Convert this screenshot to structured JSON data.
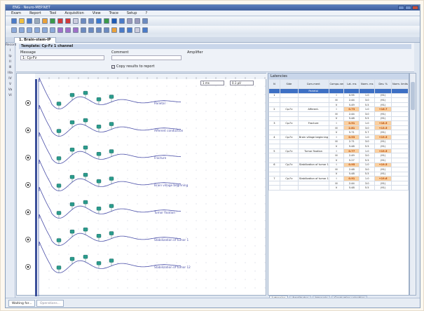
{
  "window": {
    "title": "ENG · Neuro-MEP.NET"
  },
  "menu": [
    "Exam",
    "Report",
    "Tool",
    "Acquisition",
    "View",
    "Trace",
    "Setup",
    "?"
  ],
  "document": {
    "tab_label": "1. Brain-stem-IP"
  },
  "info": {
    "template_label": "Template: Cp-Fz 1 channel",
    "message_label": "Message",
    "comment_label": "Comment",
    "amplifier_label": "Amplifier",
    "channel_value": "1: Cp-Fz",
    "copy_results": "Copy results to report"
  },
  "side_labels": [
    "Record",
    "I",
    "Ip",
    "II",
    "III",
    "IIIa",
    "IV",
    "V",
    "Va",
    "VI"
  ],
  "controls": {
    "scale": "1 ms",
    "sens": "0.1 μV"
  },
  "traces": [
    {
      "label": "Parietal"
    },
    {
      "label": "Afferent conduction"
    },
    {
      "label": "Fracture"
    },
    {
      "label": "Brain village beginning"
    },
    {
      "label": "Tumor fixation"
    },
    {
      "label": "Stabilization of tumor 1"
    },
    {
      "label": "Stabilization of tumor 12"
    }
  ],
  "table": {
    "title": "Latencies",
    "headers": [
      "N",
      "Side",
      "Com-ment",
      "Compo-nent",
      "Lat. ms",
      "Norm. ms",
      "Dev. %",
      "Norm. limits"
    ],
    "selected_row": [
      "",
      "",
      "Parietal",
      "",
      "",
      "",
      "",
      ""
    ],
    "rows": [
      [
        "1",
        "",
        "",
        "I",
        "0.95",
        "1.0",
        "(91)",
        ""
      ],
      [
        "",
        "",
        "",
        "III",
        "2.44",
        "3.0",
        "(91)",
        ""
      ],
      [
        "",
        "",
        "",
        "V",
        "5.49",
        "5.5",
        "(91)",
        ""
      ],
      [
        "2",
        "Cp-Fz",
        "Afferent.",
        "I",
        "0.73",
        "1.0",
        "+16.7",
        ""
      ],
      [
        "",
        "",
        "",
        "III",
        "2.44",
        "3.0",
        "(91)",
        ""
      ],
      [
        "",
        "",
        "",
        "V",
        "5.48",
        "5.5",
        "(91)",
        ""
      ],
      [
        "3",
        "Cp-Fz",
        "Fracture",
        "I",
        "0.91",
        "1.0",
        "+18.5",
        ""
      ],
      [
        "",
        "",
        "",
        "III",
        "2.81",
        "3.0",
        "+13.5",
        ""
      ],
      [
        "",
        "",
        "",
        "V",
        "5.71",
        "5.7",
        "(91)",
        ""
      ],
      [
        "4",
        "Cp-Fz",
        "Brain village beginning",
        "I",
        "0.93",
        "1.0",
        "+19.5",
        ""
      ],
      [
        "",
        "",
        "",
        "III",
        "2.71",
        "3.0",
        "(91)",
        ""
      ],
      [
        "",
        "",
        "",
        "V",
        "5.48",
        "5.5",
        "(91)",
        ""
      ],
      [
        "5",
        "Cp-Fz",
        "Tumor fixation",
        "I",
        "0.77",
        "1.0",
        "+19.5",
        ""
      ],
      [
        "",
        "",
        "",
        "III",
        "2.49",
        "3.0",
        "(91)",
        ""
      ],
      [
        "",
        "",
        "",
        "V",
        "5.27",
        "5.5",
        "(91)",
        ""
      ],
      [
        "6",
        "Cp-Fz",
        "Stabilization of tumor 1",
        "I",
        "0.95",
        "1.0",
        "+19.5",
        ""
      ],
      [
        "",
        "",
        "",
        "III",
        "2.48",
        "3.0",
        "(91)",
        ""
      ],
      [
        "",
        "",
        "",
        "V",
        "5.48",
        "5.5",
        "(91)",
        ""
      ],
      [
        "7",
        "Cp-Fz",
        "Stabilization of tumor 12",
        "I",
        "0.91",
        "1.0",
        "+19.6",
        ""
      ],
      [
        "",
        "",
        "",
        "III",
        "2.44",
        "3.0",
        "(91)",
        ""
      ],
      [
        "",
        "",
        "",
        "V",
        "5.48",
        "5.5",
        "(91)",
        ""
      ]
    ]
  },
  "bottom_tabs": [
    "Latencies",
    "Amplitudes",
    "Intervals",
    "Conduction velocities"
  ],
  "status": {
    "left": "Waiting for...",
    "mid": "Operations..."
  }
}
